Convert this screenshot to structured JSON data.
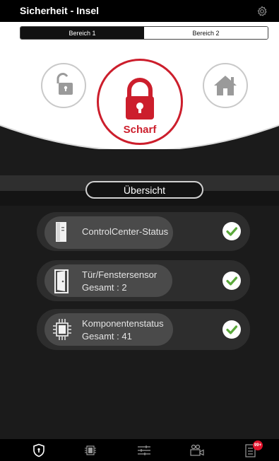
{
  "header": {
    "title": "Sicherheit - Insel",
    "settings_icon": "gear-icon"
  },
  "tabs": [
    {
      "label": "Bereich 1",
      "active": true
    },
    {
      "label": "Bereich 2",
      "active": false
    }
  ],
  "modes": {
    "disarm": {
      "icon": "unlock-icon"
    },
    "arm": {
      "label": "Scharf",
      "icon": "lock-icon",
      "color": "#cc1e2c"
    },
    "home": {
      "icon": "house-icon"
    }
  },
  "overview": {
    "label": "Übersicht"
  },
  "status_cards": [
    {
      "title": "ControlCenter-Status",
      "subtitle": "",
      "icon": "control-center-icon",
      "ok": true
    },
    {
      "title": "Tür/Fenstersensor",
      "subtitle": "Gesamt : 2",
      "icon": "door-sensor-icon",
      "ok": true
    },
    {
      "title": "Komponentenstatus",
      "subtitle": "Gesamt : 41",
      "icon": "chip-icon",
      "ok": true
    }
  ],
  "bottom_nav": {
    "items": [
      "security-shield-icon",
      "components-chip-icon",
      "controls-sliders-icon",
      "camera-icon",
      "event-log-icon"
    ],
    "notification_badge": "99+"
  },
  "colors": {
    "accent": "#cc1e2c",
    "ok_green": "#5aa83a",
    "background": "#1b1b1b"
  }
}
